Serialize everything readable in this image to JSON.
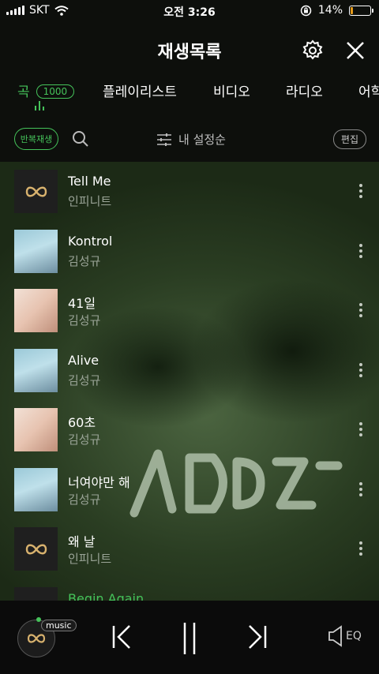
{
  "status": {
    "carrier": "SKT",
    "time": "오전 3:26",
    "battery_percent": "14%",
    "battery_level": 0.14,
    "battery_color": "#e59b1a"
  },
  "header": {
    "title": "재생목록",
    "settings_icon": "gear-icon",
    "close_icon": "close-icon"
  },
  "tabs": [
    {
      "label": "곡",
      "count": "1000",
      "active": true
    },
    {
      "label": "플레이리스트"
    },
    {
      "label": "비디오"
    },
    {
      "label": "라디오"
    },
    {
      "label": "어학"
    }
  ],
  "controls": {
    "repeat_label": "반복재생",
    "sort_label": "내 설정순",
    "edit_label": "편집"
  },
  "songs": [
    {
      "title": "Tell Me",
      "artist": "인피니트",
      "art": "infinite"
    },
    {
      "title": "Kontrol",
      "artist": "김성규",
      "art": "kontrol"
    },
    {
      "title": "41일",
      "artist": "김성규",
      "art": "portrait"
    },
    {
      "title": "Alive",
      "artist": "김성규",
      "art": "kontrol"
    },
    {
      "title": "60초",
      "artist": "김성규",
      "art": "portrait"
    },
    {
      "title": "너여야만 해",
      "artist": "김성규",
      "art": "kontrol"
    },
    {
      "title": "왜 날",
      "artist": "인피니트",
      "art": "infinite"
    },
    {
      "title": "Begin Again",
      "artist": "",
      "art": "infinite",
      "playing": true
    }
  ],
  "player": {
    "badge": "music",
    "eq_label": "EQ"
  },
  "colors": {
    "accent": "#45c35a",
    "background": "#0d0f0c"
  }
}
